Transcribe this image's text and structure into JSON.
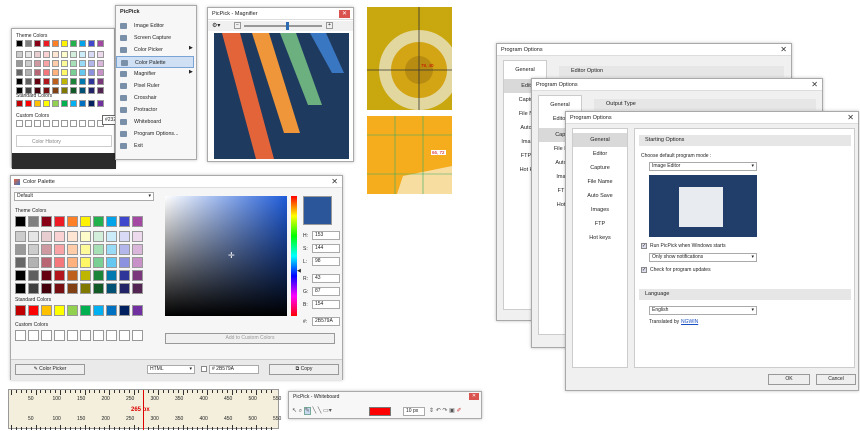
{
  "colors": {
    "theme_row": [
      "#000000",
      "#7f7f7f",
      "#880015",
      "#ed1c24",
      "#ff7f27",
      "#fff200",
      "#22b14c",
      "#00a2e8",
      "#3f48cc",
      "#a349a4"
    ],
    "standard_row": [
      "#c00000",
      "#ff0000",
      "#ffc000",
      "#ffff00",
      "#92d050",
      "#00b050",
      "#00b0f0",
      "#0070c0",
      "#002060",
      "#7030a0"
    ],
    "selected": "#2B579A",
    "whiteboard_color": "#ff0000"
  },
  "small_palette": {
    "theme_label": "Theme Colors",
    "standard_label": "Standard Colors",
    "custom_label": "Custom Colors",
    "history_label": "Color History",
    "tooltip": "#232830"
  },
  "tray_menu": {
    "title": "PicPick",
    "items": [
      {
        "label": "Image Editor",
        "icon": "image-editor-icon"
      },
      {
        "label": "Screen Capture",
        "icon": "screen-capture-icon",
        "sub": true
      },
      {
        "label": "Color Picker",
        "icon": "color-picker-icon"
      },
      {
        "label": "Color Palette",
        "icon": "color-palette-icon",
        "selected": true
      },
      {
        "label": "Magnifier",
        "icon": "magnifier-icon"
      },
      {
        "label": "Pixel Ruler",
        "icon": "pixel-ruler-icon"
      },
      {
        "label": "Crosshair",
        "icon": "crosshair-icon"
      },
      {
        "label": "Protractor",
        "icon": "protractor-icon"
      },
      {
        "label": "Whiteboard",
        "icon": "whiteboard-icon"
      },
      {
        "label": "Program Options...",
        "icon": "options-icon"
      },
      {
        "label": "Exit",
        "icon": "exit-icon"
      }
    ]
  },
  "magnifier": {
    "title": "PicPick - Magnifier",
    "zoom": "x"
  },
  "crosshair": {
    "coord1": "79, 40",
    "coord2": "66, 72"
  },
  "color_palette": {
    "title": "Color Palette",
    "preset": "Default",
    "theme_label": "Theme Colors",
    "standard_label": "Standard Colors",
    "custom_label": "Custom Colors",
    "add_custom": "Add to Custom Colors",
    "color_picker_btn": "Color Picker",
    "format": "HTML",
    "hex_value": "# 2B579A",
    "copy_btn": "Copy",
    "values": {
      "H": {
        "label": "H:",
        "value": "153"
      },
      "S": {
        "label": "S:",
        "value": "144"
      },
      "L": {
        "label": "L:",
        "value": "98"
      },
      "R": {
        "label": "R:",
        "value": "43"
      },
      "G": {
        "label": "G:",
        "value": "87"
      },
      "B": {
        "label": "B:",
        "value": "154"
      },
      "hex": {
        "label": "#:",
        "value": "2B579A"
      }
    }
  },
  "ruler": {
    "ticks": [
      "50",
      "100",
      "150",
      "200",
      "250",
      "300",
      "350",
      "400",
      "450",
      "500",
      "550"
    ],
    "position": "265 px"
  },
  "whiteboard": {
    "title": "PicPick - Whiteboard",
    "size": "10 px"
  },
  "options_back": {
    "title": "Program Options",
    "sidebar_item": "General",
    "section": "Editor Option"
  },
  "options_mid": {
    "title": "Program Options",
    "sidebar_items": [
      "General",
      "Editor",
      "Capture",
      "File Name",
      "Auto Save",
      "Images",
      "FTP",
      "Hot keys"
    ],
    "section": "Output Type"
  },
  "options_front": {
    "title": "Program Options",
    "sidebar_items": [
      "General",
      "Editor",
      "Capture",
      "File Name",
      "Auto Save",
      "Images",
      "FTP",
      "Hot keys"
    ],
    "section_startup": "Starting Options",
    "mode_label": "Choose default program mode :",
    "mode_value": "Image Editor",
    "run_startup": "Run PicPick when Windows starts",
    "notify_value": "Only show notifications",
    "check_updates": "Check for program updates",
    "section_language": "Language",
    "language_value": "English",
    "translated_prefix": "Translated by",
    "translated_by": "NGWIN",
    "ok": "OK",
    "cancel": "Cancel"
  },
  "options_back_side_partial": [
    "Edit",
    "Captu",
    "File N",
    "Auto",
    "Ima",
    "FTP",
    "Hot k"
  ],
  "options_mid_side_partial": [
    "Capt",
    "File N",
    "Auto",
    "Ima",
    "FT",
    "Hot"
  ]
}
